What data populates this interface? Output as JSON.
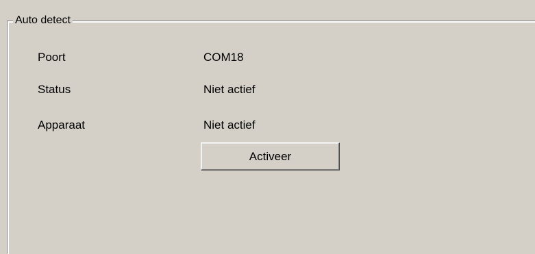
{
  "groupbox": {
    "title": "Auto detect"
  },
  "rows": [
    {
      "label": "Poort",
      "value": "COM18"
    },
    {
      "label": "Status",
      "value": "Niet actief"
    },
    {
      "label": "Apparaat",
      "value": "Niet actief"
    }
  ],
  "button": {
    "label": "Activeer"
  }
}
